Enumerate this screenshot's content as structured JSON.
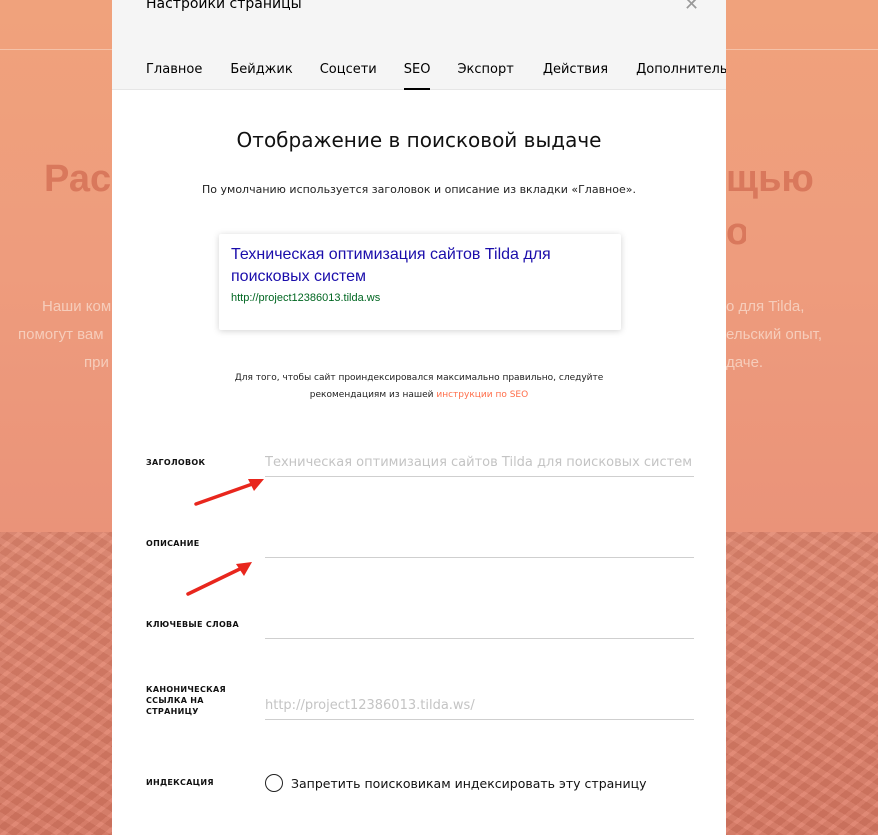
{
  "background": {
    "heading_left": "Рас",
    "heading_right": "щью",
    "heading_right2": "о",
    "para_left_1": "Наши ком",
    "para_left_2": "помогут вам",
    "para_left_3": "при",
    "para_right_1": "о для Tilda,",
    "para_right_2": "ельский опыт,",
    "para_right_3": "даче."
  },
  "modal": {
    "title": "Настройки страницы",
    "close_symbol": "✕",
    "tabs": [
      {
        "label": "Главное"
      },
      {
        "label": "Бейджик"
      },
      {
        "label": "Соцсети"
      },
      {
        "label": "SEO"
      },
      {
        "label": "Экспорт"
      },
      {
        "label": "Действия"
      },
      {
        "label": "Дополнительно"
      }
    ],
    "active_tab": "SEO",
    "section_title": "Отображение в поисковой выдаче",
    "section_sub": "По умолчанию используется заголовок и описание из вкладки «Главное».",
    "preview": {
      "title": "Техническая оптимизация сайтов Tilda для поисковых систем",
      "url": "http://project12386013.tilda.ws"
    },
    "hint": {
      "line1": "Для того, чтобы сайт проиндексировался максимально правильно, следуйте",
      "line2_prefix": "рекомендациям из нашей ",
      "link": "инструкции по SEO"
    },
    "fields": {
      "title_label": "Заголовок",
      "title_placeholder": "Техническая оптимизация сайтов Tilda для поисковых систем",
      "description_label": "Описание",
      "description_placeholder": "",
      "keywords_label": "Ключевые слова",
      "keywords_placeholder": "",
      "canonical_label_1": "Каноническая",
      "canonical_label_2": "ссылка на",
      "canonical_label_3": "страницу",
      "canonical_placeholder": "http://project12386013.tilda.ws/",
      "indexing_label": "Индексация",
      "indexing_checkbox": "Запретить поисковикам индексировать эту страницу"
    }
  },
  "colors": {
    "accent_link": "#ff6e4a",
    "arrow": "#e8261d",
    "preview_title": "#1a0dab",
    "preview_url": "#006621"
  },
  "icons": {
    "close": "close-icon",
    "arrow1": "red-arrow-icon",
    "arrow2": "red-arrow-icon"
  }
}
